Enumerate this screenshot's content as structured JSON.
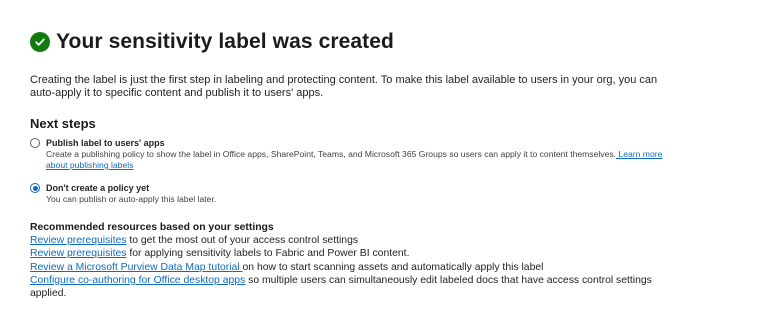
{
  "header": {
    "title": "Your sensitivity label was created",
    "success_icon": "checkmark-circle-icon",
    "success_color": "#107c10"
  },
  "intro": {
    "text": "Creating the label is just the first step in labeling and protecting content. To make this label available to users in your org, you can auto-apply it to specific content and publish it to users' apps."
  },
  "next_steps": {
    "heading": "Next steps",
    "options": [
      {
        "label": "Publish label to users' apps",
        "description": "Create a publishing policy to show the label in Office apps, SharePoint, Teams, and Microsoft 365 Groups so users can apply it to content themselves.",
        "link": " Learn more about publishing labels",
        "selected": false
      },
      {
        "label": "Don't create a policy yet",
        "description": "You can publish or auto-apply this label later.",
        "selected": true
      }
    ]
  },
  "resources": {
    "heading": "Recommended resources based on your settings",
    "items": [
      {
        "link": "Review prerequisites",
        "text": " to get the most out of your access control settings"
      },
      {
        "link": "Review prerequisites",
        "text": " for applying sensitivity labels to Fabric and Power BI content."
      },
      {
        "link": "Review a Microsoft Purview Data Map tutorial ",
        "text": "on how to start scanning assets and automatically apply this label"
      },
      {
        "link": "Configure co-authoring for Office desktop apps",
        "text": " so multiple users can simultaneously edit labeled docs that have access control settings applied."
      }
    ]
  },
  "colors": {
    "accent": "#0f6cbd",
    "text": "#242424"
  }
}
